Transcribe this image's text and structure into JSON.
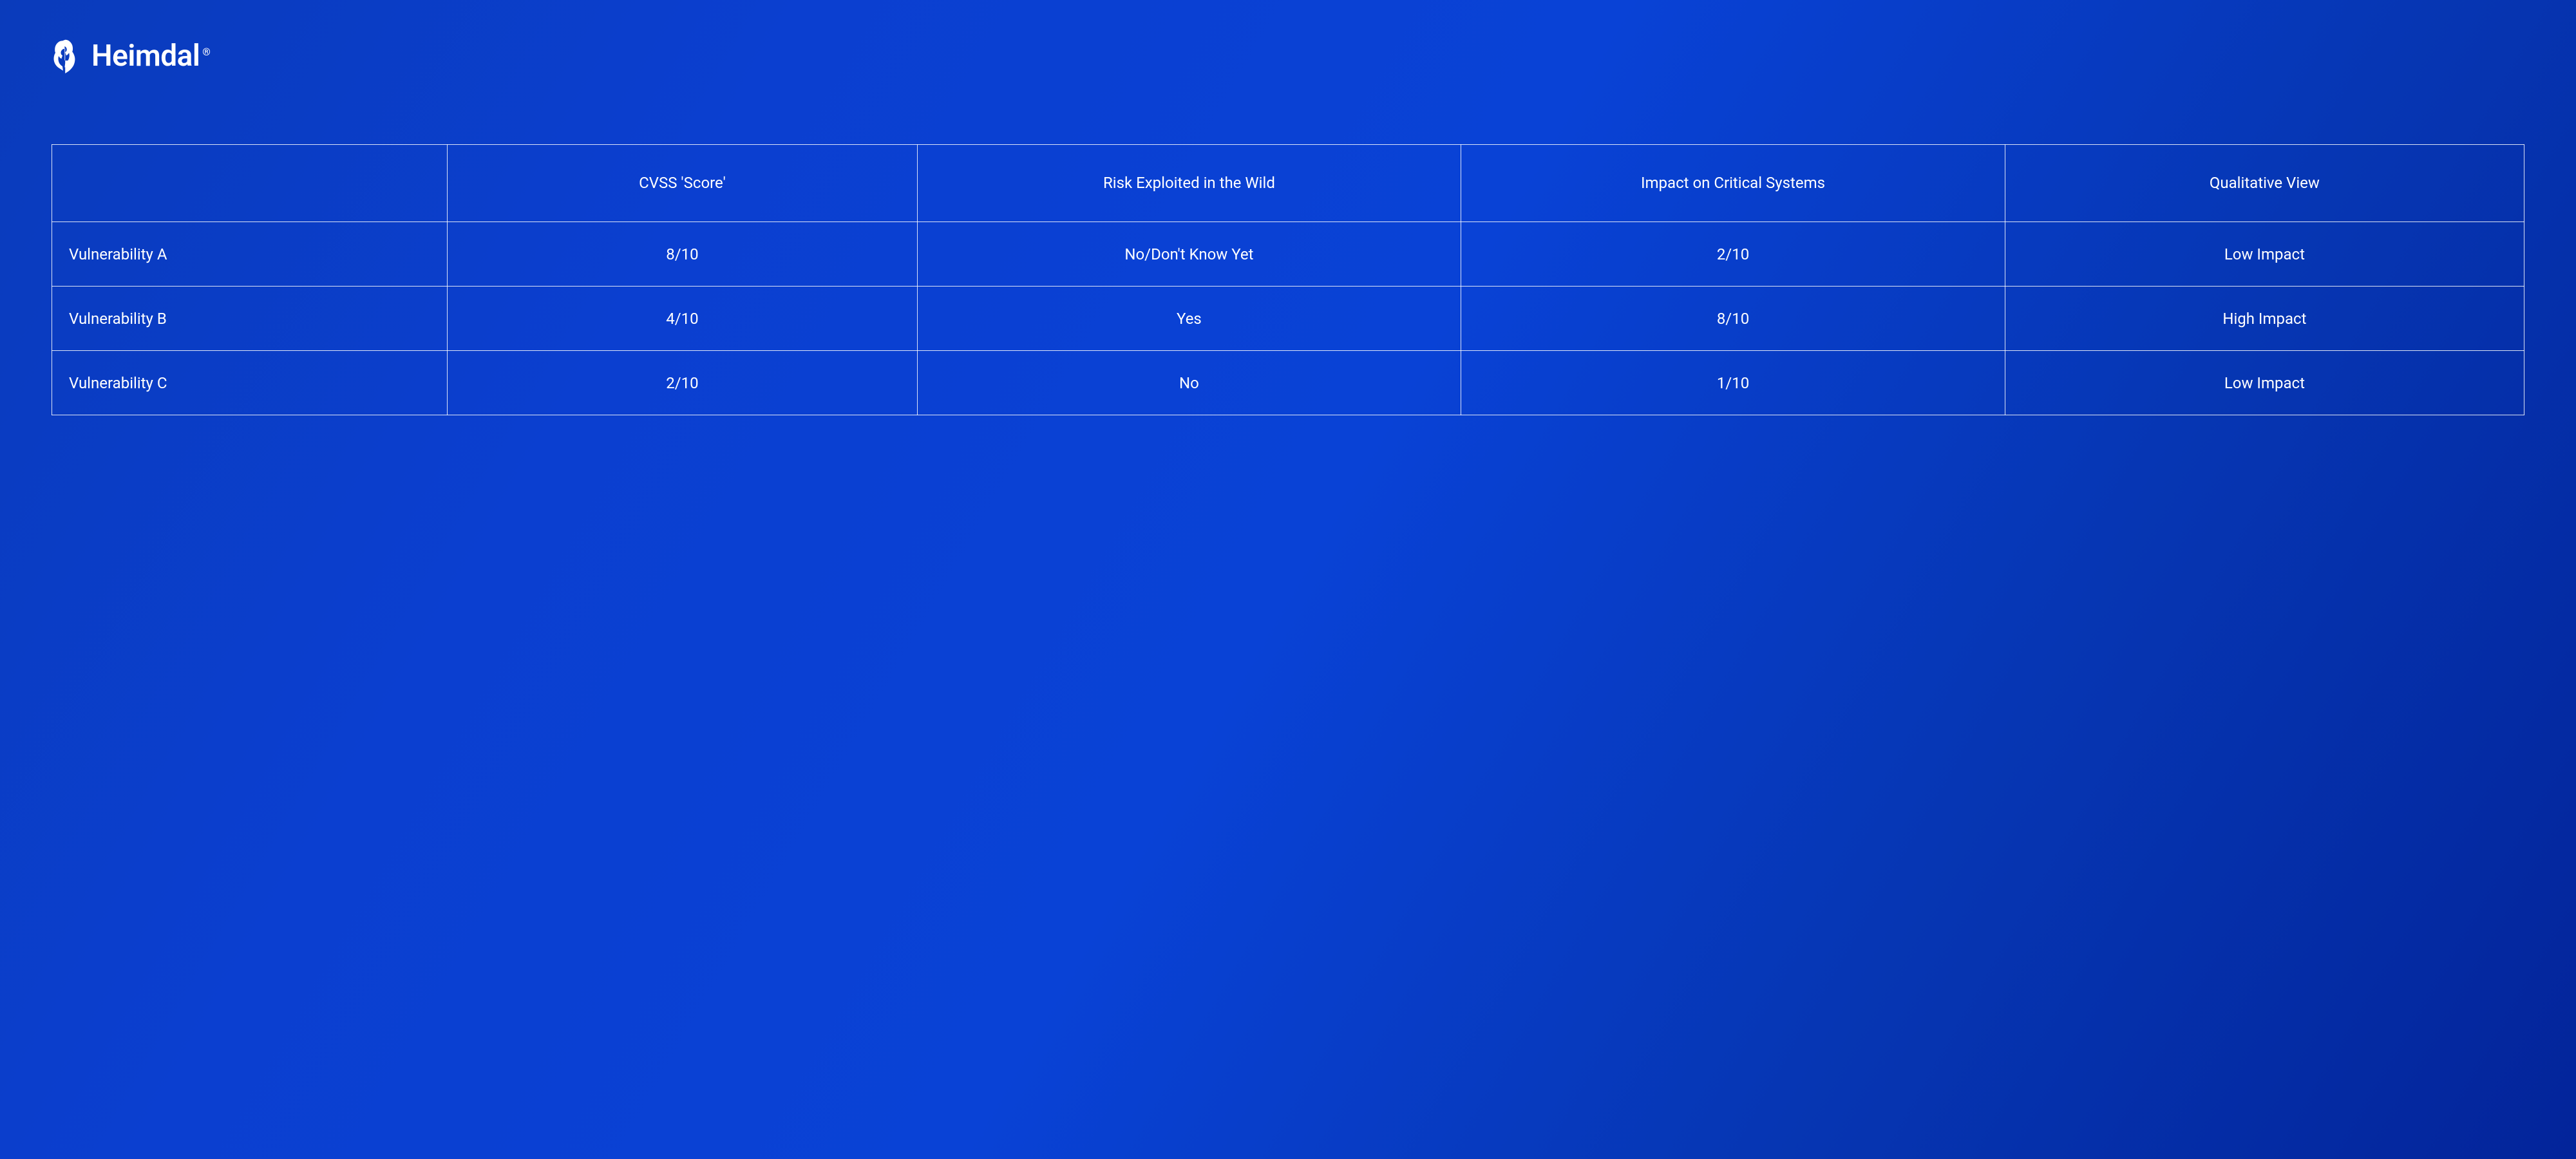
{
  "brand": {
    "name": "Heimdal",
    "registered_mark": "®"
  },
  "chart_data": {
    "type": "table",
    "title": "",
    "columns": [
      "",
      "CVSS 'Score'",
      "Risk Exploited in the Wild",
      "Impact on Critical Systems",
      "Qualitative View"
    ],
    "rows": [
      {
        "name": "Vulnerability A",
        "cvss": "8/10",
        "risk_exploited": "No/Don't Know Yet",
        "impact_critical": "2/10",
        "qualitative": "Low Impact"
      },
      {
        "name": "Vulnerability B",
        "cvss": "4/10",
        "risk_exploited": "Yes",
        "impact_critical": "8/10",
        "qualitative": "High Impact"
      },
      {
        "name": "Vulnerability C",
        "cvss": "2/10",
        "risk_exploited": "No",
        "impact_critical": "1/10",
        "qualitative": "Low Impact"
      }
    ]
  }
}
